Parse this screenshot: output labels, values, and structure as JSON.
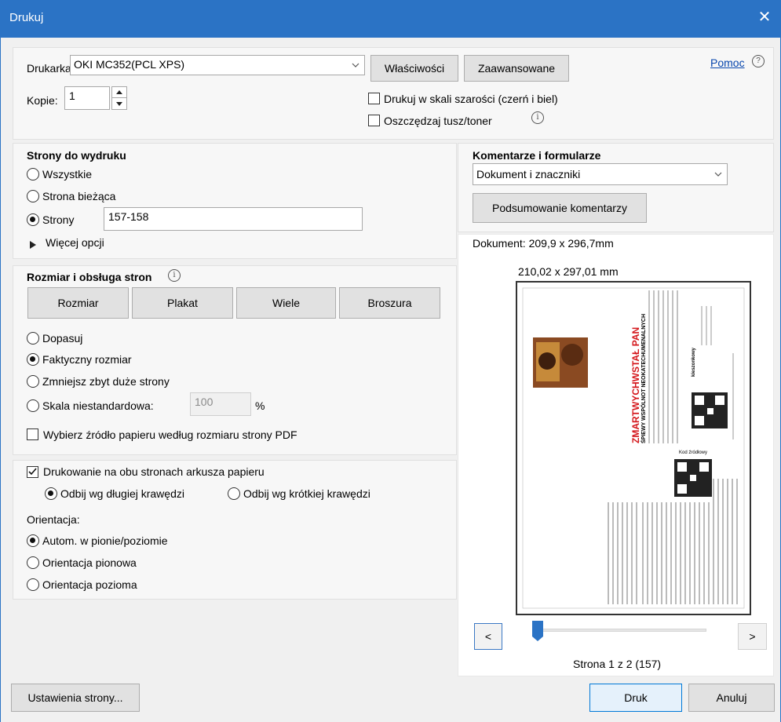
{
  "window": {
    "title": "Drukuj",
    "close_glyph": "✕"
  },
  "printer": {
    "label": "Drukarka:",
    "value": "OKI MC352(PCL XPS)",
    "properties_button": "Właściwości",
    "advanced_button": "Zaawansowane",
    "help_link": "Pomoc",
    "copies_label": "Kopie:",
    "copies_value": "1",
    "grayscale_label": "Drukuj w skali szarości (czerń i biel)",
    "save_ink_label": "Oszczędzaj tusz/toner"
  },
  "pages": {
    "heading": "Strony do wydruku",
    "all": "Wszystkie",
    "current": "Strona bieżąca",
    "pages_label": "Strony",
    "pages_value": "157-158",
    "more_options": "Więcej opcji"
  },
  "sizing": {
    "heading": "Rozmiar i obsługa stron",
    "tabs": [
      "Rozmiar",
      "Plakat",
      "Wiele",
      "Broszura"
    ],
    "fit": "Dopasuj",
    "actual": "Faktyczny rozmiar",
    "shrink": "Zmniejsz zbyt duże strony",
    "custom": "Skala niestandardowa:",
    "custom_value": "100",
    "percent": "%",
    "paper_source": "Wybierz źródło papieru według rozmiaru strony PDF"
  },
  "duplex": {
    "label": "Drukowanie na obu stronach arkusza papieru",
    "long_edge": "Odbij wg długiej krawędzi",
    "short_edge": "Odbij wg krótkiej krawędzi",
    "orientation_label": "Orientacja:",
    "auto": "Autom. w pionie/poziomie",
    "portrait": "Orientacja pionowa",
    "landscape": "Orientacja pozioma"
  },
  "comments": {
    "heading": "Komentarze i formularze",
    "value": "Dokument i znaczniki",
    "summary_button": "Podsumowanie komentarzy"
  },
  "preview": {
    "document_size": "Dokument: 209,9 x 296,7mm",
    "page_size": "210,02 x 297,01 mm",
    "page_counter": "Strona 1 z 2 (157)",
    "prev": "<",
    "next": ">",
    "doc_title": "ZMARTWYCHWSTAŁ PAN",
    "doc_subtitle": "ŚPIEWY WSPÓLNOT NEOKATECHUMENALNYCH",
    "doc_source_code": "Kod źródłowy",
    "doc_pocket": "kieszonkowy"
  },
  "footer": {
    "page_setup": "Ustawienia strony...",
    "print": "Druk",
    "cancel": "Anuluj"
  }
}
